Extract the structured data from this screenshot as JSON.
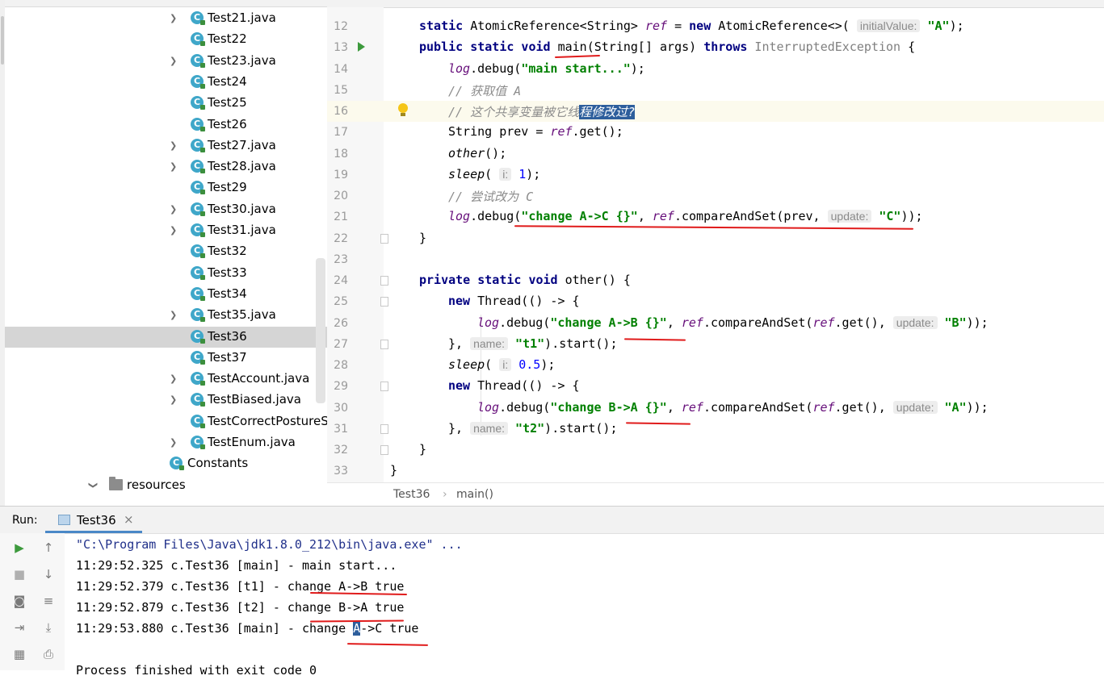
{
  "tree": {
    "items": [
      {
        "label": "Test21.java",
        "arrow": true
      },
      {
        "label": "Test22",
        "arrow": false
      },
      {
        "label": "Test23.java",
        "arrow": true
      },
      {
        "label": "Test24",
        "arrow": false
      },
      {
        "label": "Test25",
        "arrow": false
      },
      {
        "label": "Test26",
        "arrow": false
      },
      {
        "label": "Test27.java",
        "arrow": true
      },
      {
        "label": "Test28.java",
        "arrow": true
      },
      {
        "label": "Test29",
        "arrow": false
      },
      {
        "label": "Test30.java",
        "arrow": true
      },
      {
        "label": "Test31.java",
        "arrow": true
      },
      {
        "label": "Test32",
        "arrow": false
      },
      {
        "label": "Test33",
        "arrow": false
      },
      {
        "label": "Test34",
        "arrow": false
      },
      {
        "label": "Test35.java",
        "arrow": true
      },
      {
        "label": "Test36",
        "arrow": false,
        "selected": true
      },
      {
        "label": "Test37",
        "arrow": false
      },
      {
        "label": "TestAccount.java",
        "arrow": true
      },
      {
        "label": "TestBiased.java",
        "arrow": true
      },
      {
        "label": "TestCorrectPostureS",
        "arrow": false
      },
      {
        "label": "TestEnum.java",
        "arrow": true
      }
    ],
    "constants": "Constants",
    "resources": "resources"
  },
  "editor": {
    "breadcrumb_class": "Test36",
    "breadcrumb_sep": "›",
    "breadcrumb_method": "main()",
    "line_numbers": [
      "12",
      "13",
      "14",
      "15",
      "16",
      "17",
      "18",
      "19",
      "20",
      "21",
      "22",
      "23",
      "24",
      "25",
      "26",
      "27",
      "28",
      "29",
      "30",
      "31",
      "32",
      "33"
    ],
    "lines": {
      "l12": {
        "kw": "static",
        "type": " AtomicReference<String> ",
        "field": "ref",
        "eq": " = ",
        "kw2": "new",
        "ctor": " AtomicReference<>( ",
        "hint": "initialValue:",
        "str": "\"A\"",
        "end": ");"
      },
      "l13": {
        "kw": "public static void",
        "name": "main",
        "sig": "(String[] args) ",
        "kw2": "throws",
        "exc": " InterruptedException",
        "end": " {"
      },
      "l14": {
        "field": "log",
        "call": ".debug(",
        "str": "\"main start...\"",
        "end": ");"
      },
      "l15": {
        "comment": "// 获取值 A"
      },
      "l16": {
        "comment": "// 这个共享变量被它线",
        "selected": "程修改过?"
      },
      "l17": {
        "pre": "String prev = ",
        "field": "ref",
        "end": ".get();"
      },
      "l18": {
        "method": "other",
        "end": "();"
      },
      "l19": {
        "method": "sleep",
        "open": "( ",
        "hint": "i:",
        "num": "1",
        "end": ");"
      },
      "l20": {
        "comment": "// 尝试改为 C"
      },
      "l21": {
        "field": "log",
        "call": ".debug(",
        "str": "\"change A->C {}\"",
        "sep": ", ",
        "field2": "ref",
        "call2": ".compareAndSet(prev, ",
        "hint": "update:",
        "str2": "\"C\"",
        "end": "));"
      },
      "l22": {
        "text": "}"
      },
      "l24": {
        "kw": "private static void",
        "rest": " other() {"
      },
      "l25": {
        "kw": "new",
        "rest": " Thread(() -> {"
      },
      "l26": {
        "field": "log",
        "call": ".debug(",
        "str": "\"change A->B {}\"",
        "sep": ", ",
        "field2": "ref",
        "call2": ".compareAndSet(",
        "field3": "ref",
        "call3": ".get(), ",
        "hint": "update:",
        "str2": "\"B\"",
        "end": "));"
      },
      "l27": {
        "pre": "}, ",
        "hint": "name:",
        "str": "\"t1\"",
        "end": ").start();"
      },
      "l28": {
        "method": "sleep",
        "open": "( ",
        "hint": "i:",
        "num": "0.5",
        "end": ");"
      },
      "l29": {
        "kw": "new",
        "rest": " Thread(() -> {"
      },
      "l30": {
        "field": "log",
        "call": ".debug(",
        "str": "\"change B->A {}\"",
        "sep": ", ",
        "field2": "ref",
        "call2": ".compareAndSet(",
        "field3": "ref",
        "call3": ".get(), ",
        "hint": "update:",
        "str2": "\"A\"",
        "end": "));"
      },
      "l31": {
        "pre": "}, ",
        "hint": "name:",
        "str": "\"t2\"",
        "end": ").start();"
      },
      "l32": {
        "text": "}"
      },
      "l33": {
        "text": "}"
      }
    }
  },
  "run": {
    "label": "Run:",
    "tab_label": "Test36",
    "tab_close": "×",
    "console": {
      "cmd": "\"C:\\Program Files\\Java\\jdk1.8.0_212\\bin\\java.exe\" ...",
      "line1": "11:29:52.325 c.Test36 [main] - main start...",
      "line2": "11:29:52.379 c.Test36 [t1] - change A->B true",
      "line3": "11:29:52.879 c.Test36 [t2] - change B->A true",
      "line4_pre": "11:29:53.880 c.Test36 [main] - change ",
      "line4_sel": "A",
      "line4_post": "->C true",
      "line5": "Process finished with exit code 0"
    }
  },
  "colors": {
    "keyword": "#000080",
    "string": "#008000",
    "field": "#660e7a",
    "comment": "#8c8c8c",
    "annotation_red": "#e01b1b",
    "selection": "#2d5e9c"
  }
}
